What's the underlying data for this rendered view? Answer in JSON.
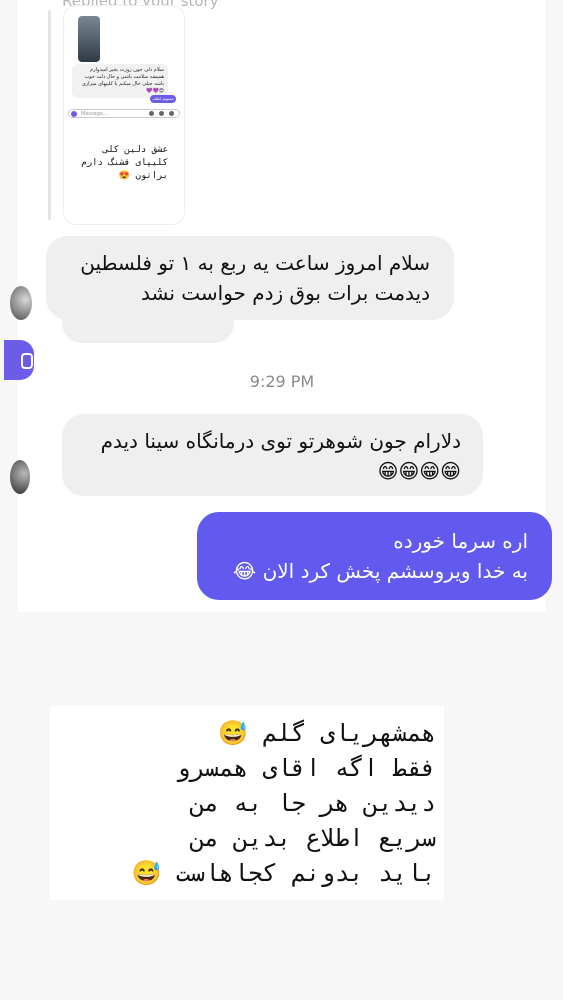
{
  "header_partial_text": "Replied to your story",
  "story": {
    "message_text": "سلام دلی جون روزت بخیر امیدوارم همیشه سلامت باشی و حال دلت خوب باشه خیلی حال میکنم با کلیپهای میزاری 😍💜💜",
    "reply_pill": "ممنونم لطف داری",
    "input_placeholder": "Message...",
    "caption": "عشق دلین کلی کلیپای\nقشنگ دارم براتون 😍"
  },
  "messages": [
    {
      "direction": "incoming",
      "text": "سلام امروز ساعت یه ربع به ۱ تو فلسطین\nدیدمت برات بوق زدم حواست نشد"
    },
    {
      "direction": "incoming",
      "text": "دلارام جون شوهرتو توی درمانگاه سینا دیدم\n😁😁😁😁"
    },
    {
      "direction": "outgoing",
      "text": "اره سرما خورده\nبه خدا ویروسشم پخش کرد الان 😂"
    }
  ],
  "under_bubble_text": "!!!!!!!!!!!!!!!!!!!!!!!!!!!!!",
  "timestamp": "9:29 PM",
  "caption_overlay": "همشهریای گلم 😅\nفقط اگه اقای همسرو\nدیدین هر جا به من\nسریع اطلاع بدین من\nباید بدونم کجاهاست 😅",
  "colors": {
    "outgoing_bubble": "#6259ef",
    "incoming_bubble": "#efefef",
    "accent": "#6c5ce7"
  }
}
